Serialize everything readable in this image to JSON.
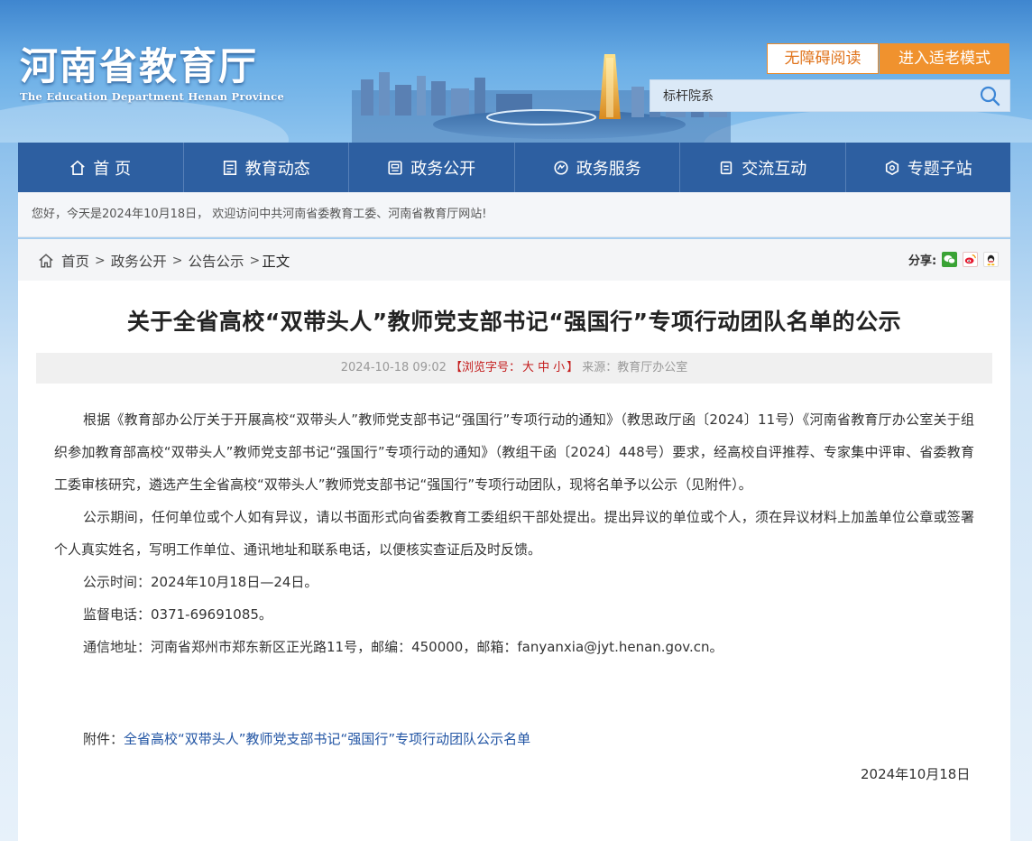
{
  "header": {
    "logo_cn": "河南省教育厅",
    "logo_en": "The Education Department Henan Province",
    "accessibility_label": "无障碍阅读",
    "elder_mode_label": "进入适老模式",
    "search_value": "标杆院系"
  },
  "nav": {
    "items": [
      {
        "label": "首 页",
        "icon": "home-icon"
      },
      {
        "label": "教育动态",
        "icon": "news-icon"
      },
      {
        "label": "政务公开",
        "icon": "document-icon"
      },
      {
        "label": "政务服务",
        "icon": "service-icon"
      },
      {
        "label": "交流互动",
        "icon": "interaction-icon"
      },
      {
        "label": "专题子站",
        "icon": "topic-icon"
      }
    ]
  },
  "welcome": "您好，今天是2024年10月18日， 欢迎访问中共河南省委教育工委、河南省教育厅网站!",
  "breadcrumb": {
    "home": "首页",
    "level1": "政务公开",
    "level2": "公告公示",
    "current": "正文",
    "sep": ">"
  },
  "share": {
    "label": "分享:"
  },
  "article": {
    "title": "关于全省高校“双带头人”教师党支部书记“强国行”专项行动团队名单的公示",
    "date": "2024-10-18 09:02",
    "font_size_prefix": "【浏览字号：",
    "font_large": "大",
    "font_medium": "中",
    "font_small": "小",
    "font_size_suffix": "】",
    "source": "来源：教育厅办公室",
    "paragraphs": [
      "根据《教育部办公厅关于开展高校“双带头人”教师党支部书记“强国行”专项行动的通知》（教思政厅函〔2024〕11号）《河南省教育厅办公室关于组织参加教育部高校“双带头人”教师党支部书记“强国行”专项行动的通知》（教组干函〔2024〕448号）要求，经高校自评推荐、专家集中评审、省委教育工委审核研究，遴选产生全省高校“双带头人”教师党支部书记“强国行”专项行动团队，现将名单予以公示（见附件）。",
      "公示期间，任何单位或个人如有异议，请以书面形式向省委教育工委组织干部处提出。提出异议的单位或个人，须在异议材料上加盖单位公章或签署个人真实姓名，写明工作单位、通讯地址和联系电话，以便核实查证后及时反馈。",
      "公示时间：2024年10月18日—24日。",
      "监督电话：0371-69691085。",
      "通信地址：河南省郑州市郑东新区正光路11号，邮编：450000，邮箱：fanyanxia@jyt.henan.gov.cn。"
    ],
    "attachment_prefix": "附件：",
    "attachment_link": "全省高校“双带头人”教师党支部书记“强国行”专项行动团队公示名单",
    "sign_date": "2024年10月18日"
  },
  "colors": {
    "nav_bg": "#2d5fa1",
    "accent_orange": "#f0922e",
    "link_blue": "#2255a4",
    "meta_red": "#c41e1e"
  }
}
